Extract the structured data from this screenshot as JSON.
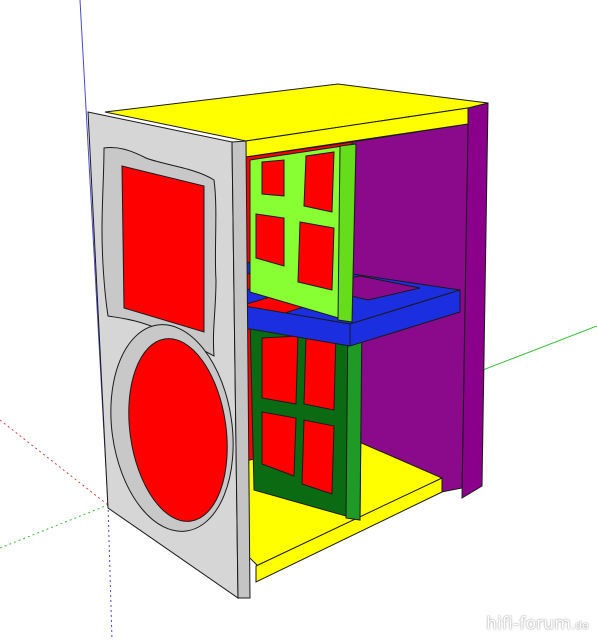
{
  "viewport": {
    "background": "#ffffff",
    "watermark": {
      "name": "hifi-forum",
      "tld": ".de"
    }
  },
  "model": {
    "description_colors": {
      "front_baffle": "#d6d6d6",
      "inner_red": "#ff0000",
      "yellow_panels": "#ffff00",
      "purple_side": "#8a008a",
      "blue_shelf": "#1c2fe0",
      "lime_brace": "#88ff33",
      "dark_green_brace": "#0a6b12",
      "axis_green": "#3cbf3c",
      "axis_red": "#c84a4a",
      "axis_blue": "#4a4ad0"
    }
  }
}
